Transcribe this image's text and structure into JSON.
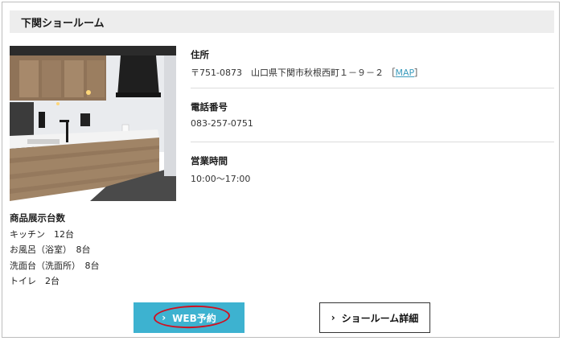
{
  "header": {
    "title": "下関ショールーム"
  },
  "info": [
    {
      "label": "住所",
      "value": "〒751-0873　山口県下関市秋根西町１－９－２",
      "link_text": "MAP"
    },
    {
      "label": "電話番号",
      "value": "083-257-0751"
    },
    {
      "label": "営業時間",
      "value": "10:00〜17:00"
    }
  ],
  "stock": {
    "title": "商品展示台数",
    "items": [
      "キッチン　12台",
      "お風呂（浴室）　8台",
      "洗面台（洗面所）　8台",
      "トイレ　2台"
    ]
  },
  "buttons": {
    "web_reserve": "WEB予約",
    "showroom_detail": "ショールーム詳細"
  },
  "icons": {
    "button_arrow": "chevron-right-icon"
  },
  "colors": {
    "accent_button": "#3db2d0",
    "link": "#3a9bbd",
    "annotation": "#d01020",
    "header_bg": "#ededed"
  }
}
